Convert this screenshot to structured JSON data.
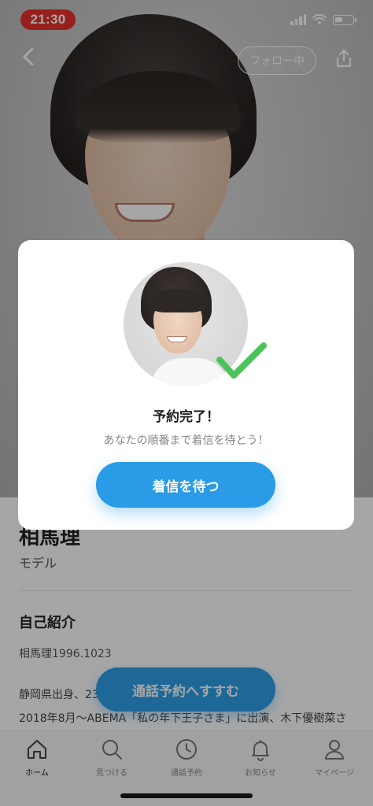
{
  "status_bar": {
    "time": "21:30",
    "time_pill_color": "#e9322f"
  },
  "header": {
    "back_icon": "chevron-left-icon",
    "follow_label": "フォロー中",
    "share_icon": "share-icon"
  },
  "profile": {
    "name": "相馬理",
    "role": "モデル",
    "section_title": "自己紹介",
    "bio": [
      "相馬理1996.1023",
      "静岡県出身、23",
      "2018年8月〜ABEMA「私の年下王子さま」に出演、木下優樹菜さ"
    ]
  },
  "reserve_button_label": "通話予約へすすむ",
  "modal": {
    "title": "予約完了！",
    "subtitle": "あなたの順番まで着信を待とう！",
    "button_label": "着信を待つ",
    "check_color": "#4cc35a"
  },
  "tab_bar": {
    "tabs": [
      {
        "label": "ホーム",
        "icon": "home-icon",
        "active": true
      },
      {
        "label": "見つける",
        "icon": "search-icon",
        "active": false
      },
      {
        "label": "通話予約",
        "icon": "clock-icon",
        "active": false
      },
      {
        "label": "お知らせ",
        "icon": "bell-icon",
        "active": false
      },
      {
        "label": "マイページ",
        "icon": "person-icon",
        "active": false
      }
    ]
  },
  "colors": {
    "accent": "#2a9be6",
    "overlay": "rgba(0,0,0,0.35)"
  }
}
